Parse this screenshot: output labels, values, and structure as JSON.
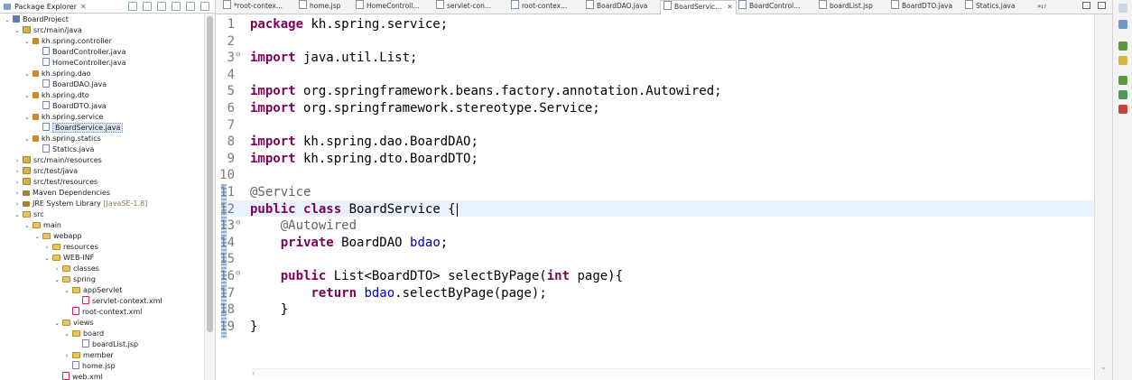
{
  "explorer": {
    "title": "Package Explorer",
    "close_label": "✕",
    "tree": [
      {
        "label": "BoardProject",
        "depth": 0,
        "icon": "project-icon",
        "expanded": true
      },
      {
        "label": "src/main/java",
        "depth": 1,
        "icon": "source-folder-icon",
        "expanded": true
      },
      {
        "label": "kh.spring.controller",
        "depth": 2,
        "icon": "package-icon",
        "expanded": true
      },
      {
        "label": "BoardController.java",
        "depth": 3,
        "icon": "java-file-icon"
      },
      {
        "label": "HomeController.java",
        "depth": 3,
        "icon": "java-file-icon"
      },
      {
        "label": "kh.spring.dao",
        "depth": 2,
        "icon": "package-icon",
        "expanded": true
      },
      {
        "label": "BoardDAO.java",
        "depth": 3,
        "icon": "java-file-icon"
      },
      {
        "label": "kh.spring.dto",
        "depth": 2,
        "icon": "package-icon",
        "expanded": true
      },
      {
        "label": "BoardDTO.java",
        "depth": 3,
        "icon": "java-file-icon"
      },
      {
        "label": "kh.spring.service",
        "depth": 2,
        "icon": "package-icon",
        "expanded": true
      },
      {
        "label": "BoardService.java",
        "depth": 3,
        "icon": "java-file-icon",
        "selected": true
      },
      {
        "label": "kh.spring.statics",
        "depth": 2,
        "icon": "package-icon",
        "expanded": true
      },
      {
        "label": "Statics.java",
        "depth": 3,
        "icon": "java-file-icon"
      },
      {
        "label": "src/main/resources",
        "depth": 1,
        "icon": "source-folder-icon"
      },
      {
        "label": "src/test/java",
        "depth": 1,
        "icon": "source-folder-icon"
      },
      {
        "label": "src/test/resources",
        "depth": 1,
        "icon": "source-folder-icon"
      },
      {
        "label": "Maven Dependencies",
        "depth": 1,
        "icon": "library-icon"
      },
      {
        "label": "JRE System Library",
        "note": "[JavaSE-1.8]",
        "depth": 1,
        "icon": "library-icon"
      },
      {
        "label": "src",
        "depth": 1,
        "icon": "folder-icon",
        "expanded": true
      },
      {
        "label": "main",
        "depth": 2,
        "icon": "folder-icon",
        "expanded": true
      },
      {
        "label": "webapp",
        "depth": 3,
        "icon": "folder-icon",
        "expanded": true
      },
      {
        "label": "resources",
        "depth": 4,
        "icon": "folder-icon"
      },
      {
        "label": "WEB-INF",
        "depth": 4,
        "icon": "folder-icon",
        "expanded": true
      },
      {
        "label": "classes",
        "depth": 5,
        "icon": "folder-icon"
      },
      {
        "label": "spring",
        "depth": 5,
        "icon": "folder-icon",
        "expanded": true
      },
      {
        "label": "appServlet",
        "depth": 6,
        "icon": "folder-icon",
        "expanded": true
      },
      {
        "label": "servlet-context.xml",
        "depth": 7,
        "icon": "xml-file-icon"
      },
      {
        "label": "root-context.xml",
        "depth": 6,
        "icon": "xml-file-icon"
      },
      {
        "label": "views",
        "depth": 5,
        "icon": "folder-icon",
        "expanded": true
      },
      {
        "label": "board",
        "depth": 6,
        "icon": "folder-icon",
        "expanded": true
      },
      {
        "label": "boardList.jsp",
        "depth": 7,
        "icon": "jsp-file-icon"
      },
      {
        "label": "member",
        "depth": 6,
        "icon": "folder-icon"
      },
      {
        "label": "home.jsp",
        "depth": 6,
        "icon": "jsp-file-icon"
      },
      {
        "label": "web.xml",
        "depth": 5,
        "icon": "xml-file-icon"
      }
    ]
  },
  "tabs": [
    {
      "label": "*root-contex...",
      "icon": "xml-file-icon"
    },
    {
      "label": "home.jsp",
      "icon": "jsp-file-icon"
    },
    {
      "label": "HomeControll...",
      "icon": "java-file-icon"
    },
    {
      "label": "servlet-con...",
      "icon": "xml-file-icon"
    },
    {
      "label": "root-contex...",
      "icon": "xml-file-icon"
    },
    {
      "label": "BoardDAO.java",
      "icon": "java-file-icon"
    },
    {
      "label": "BoardServic...",
      "icon": "java-file-icon",
      "active": true
    },
    {
      "label": "BoardControl...",
      "icon": "java-file-icon"
    },
    {
      "label": "boardList.jsp",
      "icon": "jsp-file-icon"
    },
    {
      "label": "BoardDTO.java",
      "icon": "java-file-icon"
    },
    {
      "label": "Statics.java",
      "icon": "java-file-icon"
    }
  ],
  "tab_overflow": "»₁₇",
  "editor": {
    "lines": [
      {
        "n": "1",
        "tokens": [
          [
            "kw",
            "package"
          ],
          [
            "t",
            " kh.spring.service;"
          ]
        ]
      },
      {
        "n": "2",
        "tokens": []
      },
      {
        "n": "3",
        "fold": "⊖",
        "tokens": [
          [
            "kw",
            "import"
          ],
          [
            "t",
            " java.util.List;"
          ]
        ]
      },
      {
        "n": "4",
        "tokens": []
      },
      {
        "n": "5",
        "tokens": [
          [
            "kw",
            "import"
          ],
          [
            "t",
            " org.springframework.beans.factory.annotation.Autowired;"
          ]
        ]
      },
      {
        "n": "6",
        "tokens": [
          [
            "kw",
            "import"
          ],
          [
            "t",
            " org.springframework.stereotype.Service;"
          ]
        ]
      },
      {
        "n": "7",
        "tokens": []
      },
      {
        "n": "8",
        "tokens": [
          [
            "kw",
            "import"
          ],
          [
            "t",
            " kh.spring.dao.BoardDAO;"
          ]
        ]
      },
      {
        "n": "9",
        "tokens": [
          [
            "kw",
            "import"
          ],
          [
            "t",
            " kh.spring.dto.BoardDTO;"
          ]
        ]
      },
      {
        "n": "10",
        "tokens": []
      },
      {
        "n": "11",
        "tokens": [
          [
            "ann",
            "@Service"
          ]
        ]
      },
      {
        "n": "12",
        "tokens": [
          [
            "kw",
            "public"
          ],
          [
            "t",
            " "
          ],
          [
            "kw",
            "class"
          ],
          [
            "t",
            " BoardService {"
          ]
        ]
      },
      {
        "n": "13",
        "fold": "⊖",
        "tokens": [
          [
            "t",
            "    "
          ],
          [
            "ann",
            "@Autowired"
          ]
        ]
      },
      {
        "n": "14",
        "tokens": [
          [
            "t",
            "    "
          ],
          [
            "kw",
            "private"
          ],
          [
            "t",
            " BoardDAO "
          ],
          [
            "fld",
            "bdao"
          ],
          [
            "t",
            ";"
          ]
        ]
      },
      {
        "n": "15",
        "tokens": []
      },
      {
        "n": "16",
        "fold": "⊖",
        "tokens": [
          [
            "t",
            "    "
          ],
          [
            "kw",
            "public"
          ],
          [
            "t",
            " List<BoardDTO> selectByPage("
          ],
          [
            "kw",
            "int"
          ],
          [
            "t",
            " page){"
          ]
        ]
      },
      {
        "n": "17",
        "tokens": [
          [
            "t",
            "        "
          ],
          [
            "kw",
            "return"
          ],
          [
            "t",
            " "
          ],
          [
            "fld",
            "bdao"
          ],
          [
            "t",
            ".selectByPage(page);"
          ]
        ]
      },
      {
        "n": "18",
        "tokens": [
          [
            "t",
            "    }"
          ]
        ]
      },
      {
        "n": "19",
        "tokens": [
          [
            "t",
            "}"
          ]
        ]
      }
    ]
  }
}
